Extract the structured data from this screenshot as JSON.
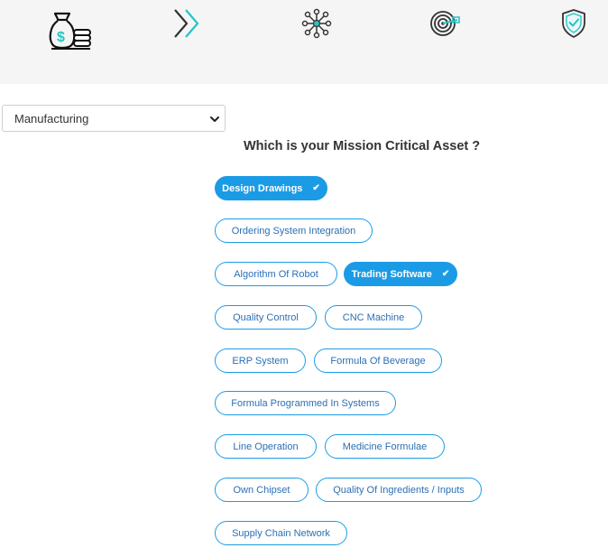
{
  "steps": [
    {
      "icon": "money-bag-icon"
    },
    {
      "icon": "double-chevron-right-icon"
    },
    {
      "icon": "network-hub-icon"
    },
    {
      "icon": "target-icon"
    },
    {
      "icon": "shield-check-icon"
    }
  ],
  "industry_select": {
    "value": "Manufacturing"
  },
  "question": "Which is your Mission Critical Asset ?",
  "assets": [
    {
      "label": "Design Drawings",
      "selected": true
    },
    {
      "label": "Ordering System Integration",
      "selected": false
    },
    {
      "label": "Algorithm Of Robot",
      "selected": false
    },
    {
      "label": "Trading Software",
      "selected": true
    },
    {
      "label": "Quality Control",
      "selected": false
    },
    {
      "label": "CNC Machine",
      "selected": false
    },
    {
      "label": "ERP System",
      "selected": false
    },
    {
      "label": "Formula Of Beverage",
      "selected": false
    },
    {
      "label": "Formula Programmed In Systems",
      "selected": false
    },
    {
      "label": "Line Operation",
      "selected": false
    },
    {
      "label": "Medicine Formulae",
      "selected": false
    },
    {
      "label": "Own Chipset",
      "selected": false
    },
    {
      "label": "Quality Of Ingredients / Inputs",
      "selected": false
    },
    {
      "label": "Supply Chain Network",
      "selected": false
    }
  ],
  "colors": {
    "accent": "#1b9be6",
    "chip_text": "#2b6fb5",
    "teal": "#27c4c4"
  }
}
